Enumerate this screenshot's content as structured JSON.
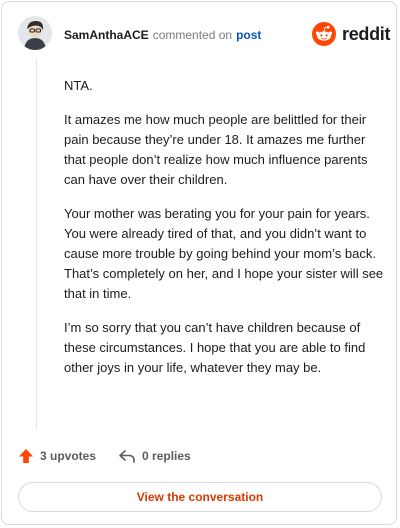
{
  "header": {
    "username": "SamAnthaACE",
    "meta_text": "commented on",
    "post_link": "post",
    "logo_text": "reddit",
    "brand_color": "#ff4500"
  },
  "comment": {
    "paragraphs": [
      "NTA.",
      "It amazes me how much people are belittled for their pain because they’re under 18. It amazes me further that people don’t realize how much influence parents can have over their children.",
      "Your mother was berating you for your pain for years. You were already tired of that, and you didn’t want to cause more trouble by going behind your mom’s back. That’s completely on her, and I hope your sister will see that in time.",
      "I’m so sorry that you can’t have children because of these circumstances. I hope that you are able to find other joys in your life, whatever they may be."
    ]
  },
  "actions": {
    "upvotes_label": "3 upvotes",
    "replies_label": "0 replies",
    "upvote_icon": "arrow-up-icon",
    "reply_icon": "reply-icon"
  },
  "cta": {
    "label": "View the conversation",
    "color": "#d93a00"
  }
}
